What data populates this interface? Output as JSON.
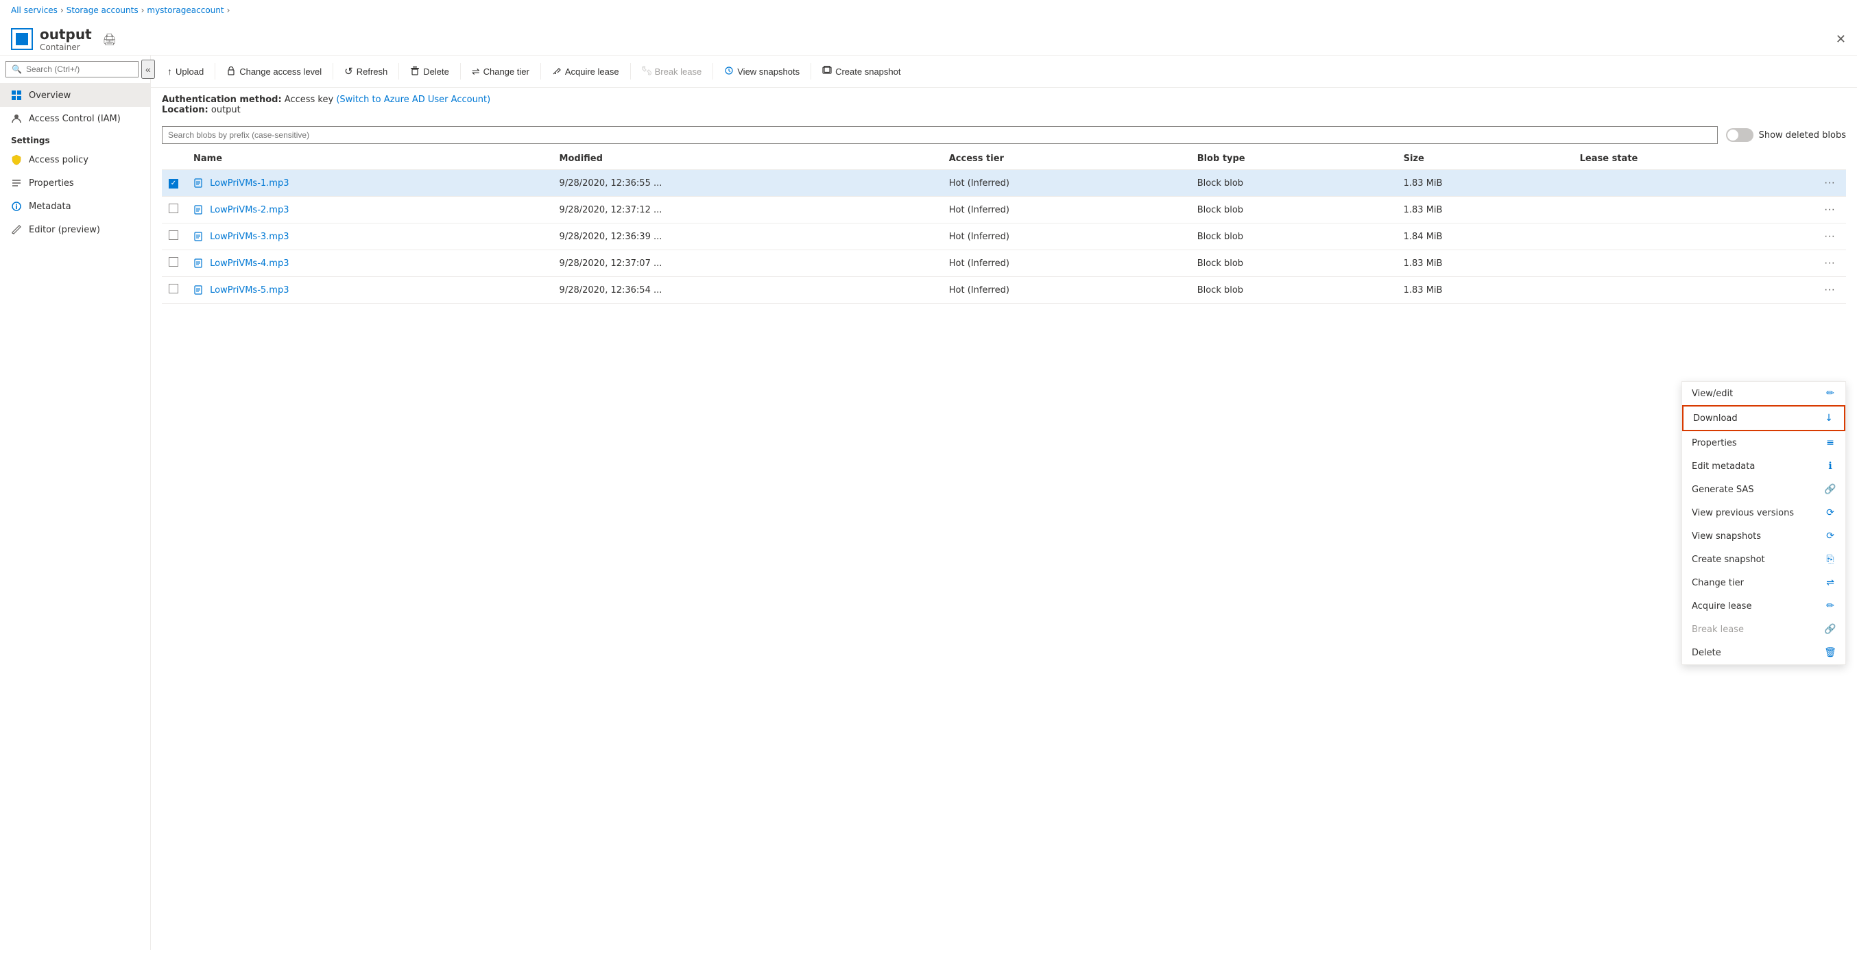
{
  "breadcrumb": {
    "items": [
      "All services",
      "Storage accounts",
      "mystorageaccount"
    ],
    "separators": [
      ">",
      ">",
      ">"
    ]
  },
  "header": {
    "icon_label": "output-icon",
    "title": "output",
    "subtitle": "Container",
    "print_label": "🖨",
    "close_label": "✕"
  },
  "sidebar": {
    "search_placeholder": "Search (Ctrl+/)",
    "collapse_label": "«",
    "nav_items": [
      {
        "id": "overview",
        "label": "Overview",
        "icon": "overview",
        "active": true
      },
      {
        "id": "iam",
        "label": "Access Control (IAM)",
        "icon": "iam",
        "active": false
      }
    ],
    "settings_label": "Settings",
    "settings_items": [
      {
        "id": "access-policy",
        "label": "Access policy",
        "icon": "policy"
      },
      {
        "id": "properties",
        "label": "Properties",
        "icon": "props"
      },
      {
        "id": "metadata",
        "label": "Metadata",
        "icon": "meta"
      },
      {
        "id": "editor",
        "label": "Editor (preview)",
        "icon": "editor"
      }
    ]
  },
  "toolbar": {
    "buttons": [
      {
        "id": "upload",
        "label": "Upload",
        "icon": "↑",
        "disabled": false
      },
      {
        "id": "change-access",
        "label": "Change access level",
        "icon": "🔒",
        "disabled": false
      },
      {
        "id": "refresh",
        "label": "Refresh",
        "icon": "↺",
        "disabled": false
      },
      {
        "id": "delete",
        "label": "Delete",
        "icon": "🗑",
        "disabled": false
      },
      {
        "id": "change-tier",
        "label": "Change tier",
        "icon": "⇌",
        "disabled": false
      },
      {
        "id": "acquire-lease",
        "label": "Acquire lease",
        "icon": "✏",
        "disabled": false
      },
      {
        "id": "break-lease",
        "label": "Break lease",
        "icon": "🔗",
        "disabled": true
      },
      {
        "id": "view-snapshots",
        "label": "View snapshots",
        "icon": "⟳",
        "disabled": false
      },
      {
        "id": "create-snapshot",
        "label": "Create snapshot",
        "icon": "⎘",
        "disabled": false
      }
    ]
  },
  "auth": {
    "label": "Authentication method:",
    "method": "Access key",
    "switch_text": "(Switch to Azure AD User Account)",
    "location_label": "Location:",
    "location_value": "output"
  },
  "blob_search": {
    "placeholder": "Search blobs by prefix (case-sensitive)",
    "show_deleted_label": "Show deleted blobs"
  },
  "table": {
    "columns": [
      "",
      "Name",
      "Modified",
      "Access tier",
      "Blob type",
      "Size",
      "Lease state",
      ""
    ],
    "rows": [
      {
        "id": 1,
        "checked": true,
        "name": "LowPriVMs-1.mp3",
        "modified": "9/28/2020, 12:36:55 ...",
        "access_tier": "Hot (Inferred)",
        "blob_type": "Block blob",
        "size": "1.83 MiB",
        "lease_state": ""
      },
      {
        "id": 2,
        "checked": false,
        "name": "LowPriVMs-2.mp3",
        "modified": "9/28/2020, 12:37:12 ...",
        "access_tier": "Hot (Inferred)",
        "blob_type": "Block blob",
        "size": "1.83 MiB",
        "lease_state": ""
      },
      {
        "id": 3,
        "checked": false,
        "name": "LowPriVMs-3.mp3",
        "modified": "9/28/2020, 12:36:39 ...",
        "access_tier": "Hot (Inferred)",
        "blob_type": "Block blob",
        "size": "1.84 MiB",
        "lease_state": ""
      },
      {
        "id": 4,
        "checked": false,
        "name": "LowPriVMs-4.mp3",
        "modified": "9/28/2020, 12:37:07 ...",
        "access_tier": "Hot (Inferred)",
        "blob_type": "Block blob",
        "size": "1.83 MiB",
        "lease_state": ""
      },
      {
        "id": 5,
        "checked": false,
        "name": "LowPriVMs-5.mp3",
        "modified": "9/28/2020, 12:36:54 ...",
        "access_tier": "Hot (Inferred)",
        "blob_type": "Block blob",
        "size": "1.83 MiB",
        "lease_state": ""
      }
    ]
  },
  "context_menu": {
    "items": [
      {
        "id": "view-edit",
        "label": "View/edit",
        "icon": "✏",
        "disabled": false,
        "highlighted": false
      },
      {
        "id": "download",
        "label": "Download",
        "icon": "↓",
        "disabled": false,
        "highlighted": true
      },
      {
        "id": "properties",
        "label": "Properties",
        "icon": "≡",
        "disabled": false,
        "highlighted": false
      },
      {
        "id": "edit-metadata",
        "label": "Edit metadata",
        "icon": "ℹ",
        "disabled": false,
        "highlighted": false
      },
      {
        "id": "generate-sas",
        "label": "Generate SAS",
        "icon": "🔗",
        "disabled": false,
        "highlighted": false
      },
      {
        "id": "view-prev-versions",
        "label": "View previous versions",
        "icon": "⟳",
        "disabled": false,
        "highlighted": false
      },
      {
        "id": "view-snapshots",
        "label": "View snapshots",
        "icon": "⟳",
        "disabled": false,
        "highlighted": false
      },
      {
        "id": "create-snapshot",
        "label": "Create snapshot",
        "icon": "⎘",
        "disabled": false,
        "highlighted": false
      },
      {
        "id": "change-tier",
        "label": "Change tier",
        "icon": "⇌",
        "disabled": false,
        "highlighted": false
      },
      {
        "id": "acquire-lease",
        "label": "Acquire lease",
        "icon": "✏",
        "disabled": false,
        "highlighted": false
      },
      {
        "id": "break-lease",
        "label": "Break lease",
        "icon": "🔗",
        "disabled": true,
        "highlighted": false
      },
      {
        "id": "delete",
        "label": "Delete",
        "icon": "🗑",
        "disabled": false,
        "highlighted": false
      }
    ]
  },
  "colors": {
    "accent": "#0078d4",
    "highlight_border": "#d83b01",
    "bg_selected": "#deecf9",
    "text_muted": "#a19f9d"
  }
}
